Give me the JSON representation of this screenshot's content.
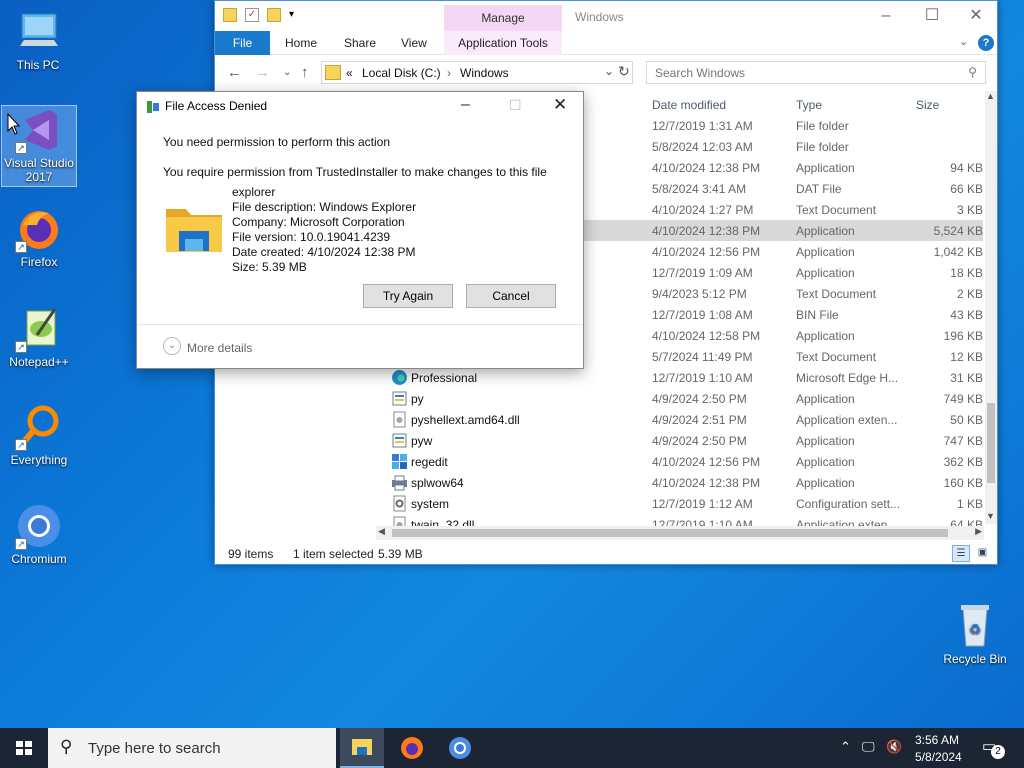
{
  "desktop": {
    "icons": [
      {
        "label": "This PC"
      },
      {
        "label": "Visual Studio 2017"
      },
      {
        "label": "Firefox"
      },
      {
        "label": "Notepad++"
      },
      {
        "label": "Everything"
      },
      {
        "label": "Chromium"
      },
      {
        "label": "Recycle Bin"
      }
    ]
  },
  "explorer": {
    "window_title": "Windows",
    "manage_tab": "Manage",
    "ribbon_tabs": [
      "File",
      "Home",
      "Share",
      "View",
      "Application Tools"
    ],
    "address": {
      "prefix": "«",
      "crumbs": [
        "Local Disk (C:)",
        "Windows"
      ]
    },
    "search_placeholder": "Search Windows",
    "columns": {
      "date": "Date modified",
      "type": "Type",
      "size": "Size"
    },
    "rows": [
      {
        "name": "",
        "date": "12/7/2019 1:31 AM",
        "type": "File folder",
        "size": ""
      },
      {
        "name": "",
        "date": "5/8/2024 12:03 AM",
        "type": "File folder",
        "size": ""
      },
      {
        "name": "",
        "date": "4/10/2024 12:38 PM",
        "type": "Application",
        "size": "94 KB"
      },
      {
        "name": "",
        "date": "5/8/2024 3:41 AM",
        "type": "DAT File",
        "size": "66 KB"
      },
      {
        "name": "",
        "date": "4/10/2024 1:27 PM",
        "type": "Text Document",
        "size": "3 KB"
      },
      {
        "name": "",
        "date": "4/10/2024 12:38 PM",
        "type": "Application",
        "size": "5,524 KB",
        "selected": true
      },
      {
        "name": "",
        "date": "4/10/2024 12:56 PM",
        "type": "Application",
        "size": "1,042 KB"
      },
      {
        "name": "",
        "date": "12/7/2019 1:09 AM",
        "type": "Application",
        "size": "18 KB"
      },
      {
        "name": "",
        "date": "9/4/2023 5:12 PM",
        "type": "Text Document",
        "size": "2 KB"
      },
      {
        "name": "",
        "date": "12/7/2019 1:08 AM",
        "type": "BIN File",
        "size": "43 KB"
      },
      {
        "name": "",
        "date": "4/10/2024 12:58 PM",
        "type": "Application",
        "size": "196 KB"
      },
      {
        "name": "",
        "date": "5/7/2024 11:49 PM",
        "type": "Text Document",
        "size": "12 KB"
      },
      {
        "name": "Professional",
        "date": "12/7/2019 1:10 AM",
        "type": "Microsoft Edge H...",
        "size": "31 KB",
        "icon": "edge"
      },
      {
        "name": "py",
        "date": "4/9/2024 2:50 PM",
        "type": "Application",
        "size": "749 KB",
        "icon": "py"
      },
      {
        "name": "pyshellext.amd64.dll",
        "date": "4/9/2024 2:51 PM",
        "type": "Application exten...",
        "size": "50 KB",
        "icon": "dll"
      },
      {
        "name": "pyw",
        "date": "4/9/2024 2:50 PM",
        "type": "Application",
        "size": "747 KB",
        "icon": "py"
      },
      {
        "name": "regedit",
        "date": "4/10/2024 12:56 PM",
        "type": "Application",
        "size": "362 KB",
        "icon": "reg"
      },
      {
        "name": "splwow64",
        "date": "4/10/2024 12:38 PM",
        "type": "Application",
        "size": "160 KB",
        "icon": "printer"
      },
      {
        "name": "system",
        "date": "12/7/2019 1:12 AM",
        "type": "Configuration sett...",
        "size": "1 KB",
        "icon": "ini"
      },
      {
        "name": "twain_32.dll",
        "date": "12/7/2019 1:10 AM",
        "type": "Application exten...",
        "size": "64 KB",
        "icon": "dll"
      }
    ],
    "status": {
      "items": "99 items",
      "selected": "1 item selected",
      "size": "5.39 MB"
    }
  },
  "dialog": {
    "title": "File Access Denied",
    "heading": "You need permission to perform this action",
    "message": "You require permission from TrustedInstaller to make changes to this file",
    "file": {
      "name": "explorer",
      "description": "File description: Windows Explorer",
      "company": "Company: Microsoft Corporation",
      "version": "File version: 10.0.19041.4239",
      "created": "Date created: 4/10/2024 12:38 PM",
      "size": "Size: 5.39 MB"
    },
    "try_again": "Try Again",
    "cancel": "Cancel",
    "more_details": "More details"
  },
  "taskbar": {
    "search_placeholder": "Type here to search",
    "time": "3:56 AM",
    "date": "5/8/2024",
    "notifications": "2"
  }
}
